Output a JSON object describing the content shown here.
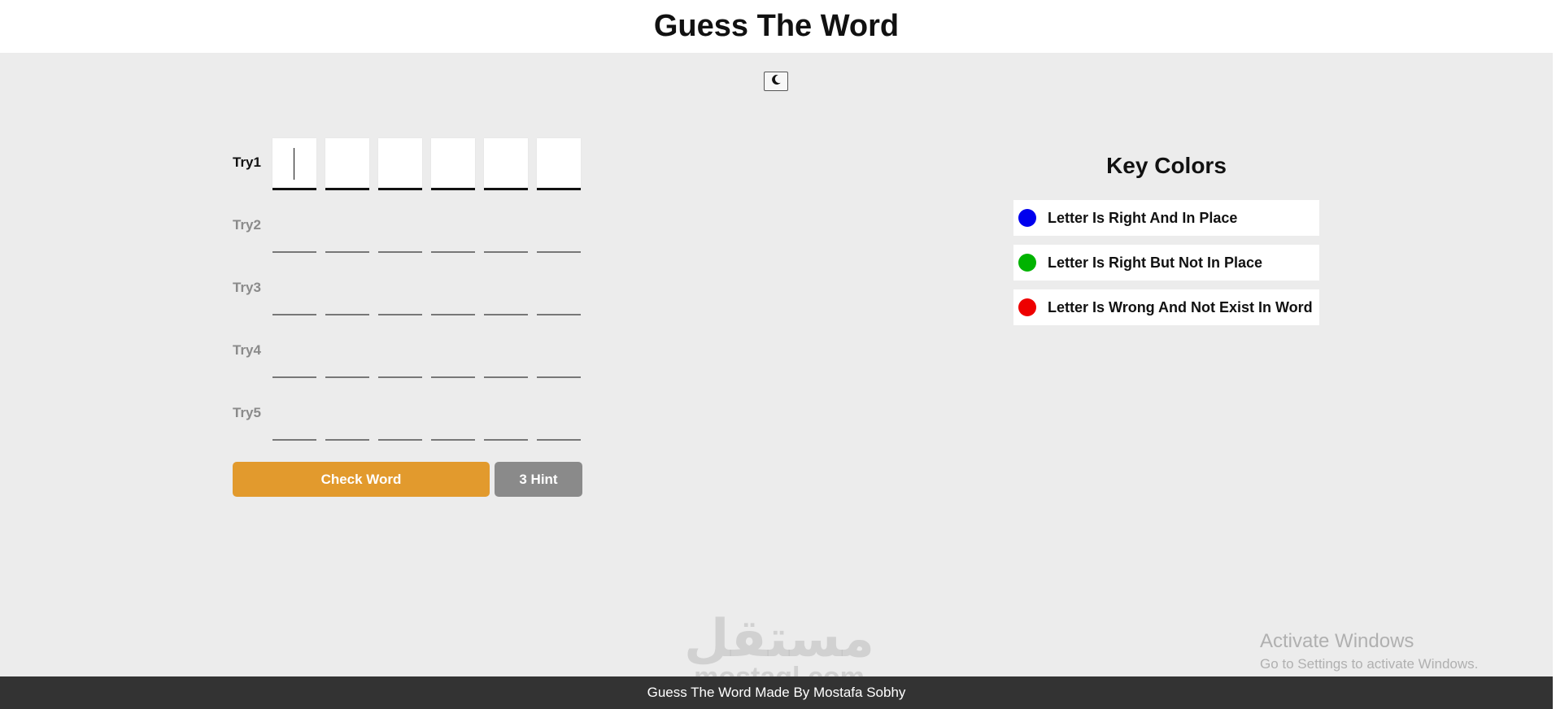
{
  "header": {
    "title": "Guess The Word"
  },
  "theme_toggle": {
    "icon": "moon-icon"
  },
  "tries": [
    {
      "label": "Try1",
      "active": true,
      "letters": [
        "",
        "",
        "",
        "",
        "",
        ""
      ]
    },
    {
      "label": "Try2",
      "active": false,
      "letters": [
        "",
        "",
        "",
        "",
        "",
        ""
      ]
    },
    {
      "label": "Try3",
      "active": false,
      "letters": [
        "",
        "",
        "",
        "",
        "",
        ""
      ]
    },
    {
      "label": "Try4",
      "active": false,
      "letters": [
        "",
        "",
        "",
        "",
        "",
        ""
      ]
    },
    {
      "label": "Try5",
      "active": false,
      "letters": [
        "",
        "",
        "",
        "",
        "",
        ""
      ]
    }
  ],
  "actions": {
    "check_label": "Check Word",
    "hint_label": "3 Hint"
  },
  "key_colors": {
    "title": "Key Colors",
    "items": [
      {
        "label": "Letter Is Right And In Place",
        "color": "#0000ee"
      },
      {
        "label": "Letter Is Right But Not In Place",
        "color": "#00b300"
      },
      {
        "label": "Letter Is Wrong And Not Exist In Word",
        "color": "#ee0000"
      }
    ]
  },
  "system_overlay": {
    "title": "Activate Windows",
    "subtitle": "Go to Settings to activate Windows."
  },
  "watermark": {
    "arabic": "مستقل",
    "latin": "mostaql.com"
  },
  "footer": {
    "text": "Guess The Word Made By Mostafa Sobhy"
  },
  "colors": {
    "background": "#ececec",
    "check_button": "#e29a2d",
    "hint_button": "#8a8a8a",
    "footer": "#333333"
  }
}
